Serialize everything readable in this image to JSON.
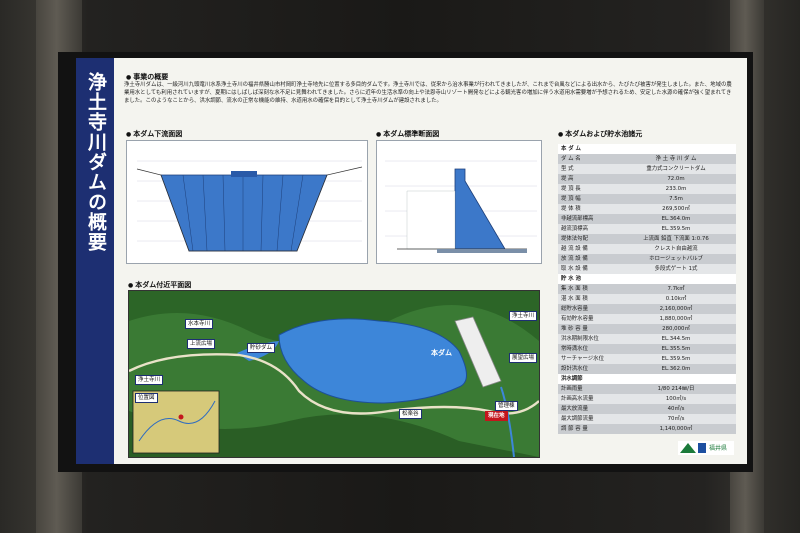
{
  "title": "浄土寺川ダムの概要",
  "sections": {
    "overview": "事業の概要",
    "downstream": "本ダム下流面図",
    "section": "本ダム標準断面図",
    "specs": "本ダムおよび貯水池諸元",
    "plan": "本ダム付近平面図"
  },
  "intro": "浄土寺川ダムは、一級河川九頭竜川水系浄土寺川の福井県勝山市村岡町浄土寺地先に位置する多目的ダムです。浄土寺川では、従来から治水事業が行われてきましたが、これまで台風などによる出水から、たびたび被害が発生しました。また、地域の農業用水としても利用されていますが、夏期にはしばしば深刻な水不足に見舞われてきました。さらに近年の生活水準の向上や法恩寺山リゾート開発などによる観光客の増加に伴う水道用水需要増が予想されるため、安定した水源の確保が強く望まれてきました。このようなことから、洪水調節、流水の正常な機能の維持、水道用水の確保を目的として浄土寺川ダムが建設されました。",
  "spec_table": [
    {
      "k": "本 ダ ム",
      "v": "",
      "s": "h"
    },
    {
      "k": "ダ ム 名",
      "v": "浄 土 寺 川 ダ ム",
      "s": "g"
    },
    {
      "k": "型 式",
      "v": "重力式コンクリートダム",
      "s": "w"
    },
    {
      "k": "堤 高",
      "v": "72.0m",
      "s": "g"
    },
    {
      "k": "堤 頂 長",
      "v": "233.0m",
      "s": "w"
    },
    {
      "k": "堤 頂 幅",
      "v": "7.5m",
      "s": "g"
    },
    {
      "k": "堤 体 積",
      "v": "269,500㎥",
      "s": "w"
    },
    {
      "k": "非越流部標高",
      "v": "EL.364.0m",
      "s": "g"
    },
    {
      "k": "越流頂標高",
      "v": "EL.359.5m",
      "s": "w"
    },
    {
      "k": "堤体法勾配",
      "v": "上流面 鉛直  下流面 1:0.76",
      "s": "g"
    },
    {
      "k": "越 流 設 備",
      "v": "クレスト自由越流",
      "s": "w"
    },
    {
      "k": "放 流 設 備",
      "v": "ホロージェットバルブ",
      "s": "g"
    },
    {
      "k": "取 水 設 備",
      "v": "多段式ゲート 1式",
      "s": "w"
    },
    {
      "k": "貯 水 池",
      "v": "",
      "s": "h"
    },
    {
      "k": "集 水 面 積",
      "v": "7.7k㎡",
      "s": "g"
    },
    {
      "k": "湛 水 面 積",
      "v": "0.10k㎡",
      "s": "w"
    },
    {
      "k": "総貯水容量",
      "v": "2,160,000㎥",
      "s": "g"
    },
    {
      "k": "有効貯水容量",
      "v": "1,880,000㎥",
      "s": "w"
    },
    {
      "k": "堆 砂 容 量",
      "v": "280,000㎥",
      "s": "g"
    },
    {
      "k": "洪水期制限水位",
      "v": "EL.344.5m",
      "s": "w"
    },
    {
      "k": "常時満水位",
      "v": "EL.355.5m",
      "s": "g"
    },
    {
      "k": "サーチャージ水位",
      "v": "EL.359.5m",
      "s": "w"
    },
    {
      "k": "設計洪水位",
      "v": "EL.362.0m",
      "s": "g"
    },
    {
      "k": "洪水調節",
      "v": "",
      "s": "h"
    },
    {
      "k": "計画雨量",
      "v": "1/80 214㎜/日",
      "s": "g"
    },
    {
      "k": "計画高水流量",
      "v": "100㎥/s",
      "s": "w"
    },
    {
      "k": "最大放流量",
      "v": "40㎥/s",
      "s": "g"
    },
    {
      "k": "最大調節流量",
      "v": "70㎥/s",
      "s": "w"
    },
    {
      "k": "調 節 容 量",
      "v": "1,140,000㎥",
      "s": "g"
    }
  ],
  "map_labels": {
    "jododeraji": "浄土寺川",
    "mizuhonji": "水本寺川",
    "kaminiwa": "上流広場",
    "jododeraji2": "浄土寺川",
    "sabo": "貯砂ダム",
    "hondam": "本ダム",
    "jododeraji3": "浄土寺川",
    "shoko": "管理棟",
    "iri": "位置図",
    "genzaichi": "現在地",
    "kanrisha": "展望広場",
    "matsumae": "松楽谷"
  },
  "logo_text": "福井県"
}
